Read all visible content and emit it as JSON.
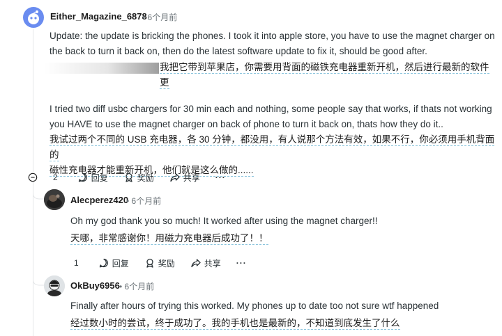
{
  "comments": [
    {
      "username": "Either_Magazine_6878",
      "time": "6个月前",
      "paragraphs": [
        "Update: the update is bricking the phones. I took it into apple store, you have to use the magnet charger on the back to turn it back on, then do the latest software update to fix it, should be good after.",
        "我把它带到苹果店，你需要用背面的磁铁充电器重新开机，然后进行最新的软件更",
        "I tried two diff usbc chargers for 30 min each and nothing, some people say that works, if thats not working you HAVE to use the magnet charger on back of phone to turn it back on, thats how they do it..",
        "我试过两个不同的 USB 充电器，各 30 分钟，都没用，有人说那个方法有效，如果不行，你必须用手机背面的",
        "磁性充电器才能重新开机，他们就是这么做的......"
      ],
      "votes": "2",
      "reply_label": "回复",
      "award_label": "奖励",
      "share_label": "共享",
      "more_label": "···"
    },
    {
      "username": "Alecperez420",
      "time": "6个月前",
      "paragraphs": [
        "Oh my god thank you so much! It worked after using the magnet charger!!",
        "天哪，非常感谢你！用磁力充电器后成功了！！"
      ],
      "votes": "1",
      "reply_label": "回复",
      "award_label": "奖励",
      "share_label": "共享",
      "more_label": "···"
    },
    {
      "username": "OkBuy6956",
      "time": "6个月前",
      "paragraphs": [
        "Finally after hours of trying this worked. My phones up to date too not sure wtf happened",
        "经过数小时的尝试，终于成功了。我的手机也是最新的，不知道到底发生了什么"
      ]
    }
  ],
  "separator": "•",
  "colors": {
    "avatar_blue": "#6a8cf0",
    "zh_underline": "#8cc5dd",
    "meta_gray": "#6b7378"
  },
  "icons": [
    "upvote-icon",
    "downvote-icon",
    "reply-icon",
    "award-icon",
    "share-icon",
    "collapse-icon"
  ]
}
